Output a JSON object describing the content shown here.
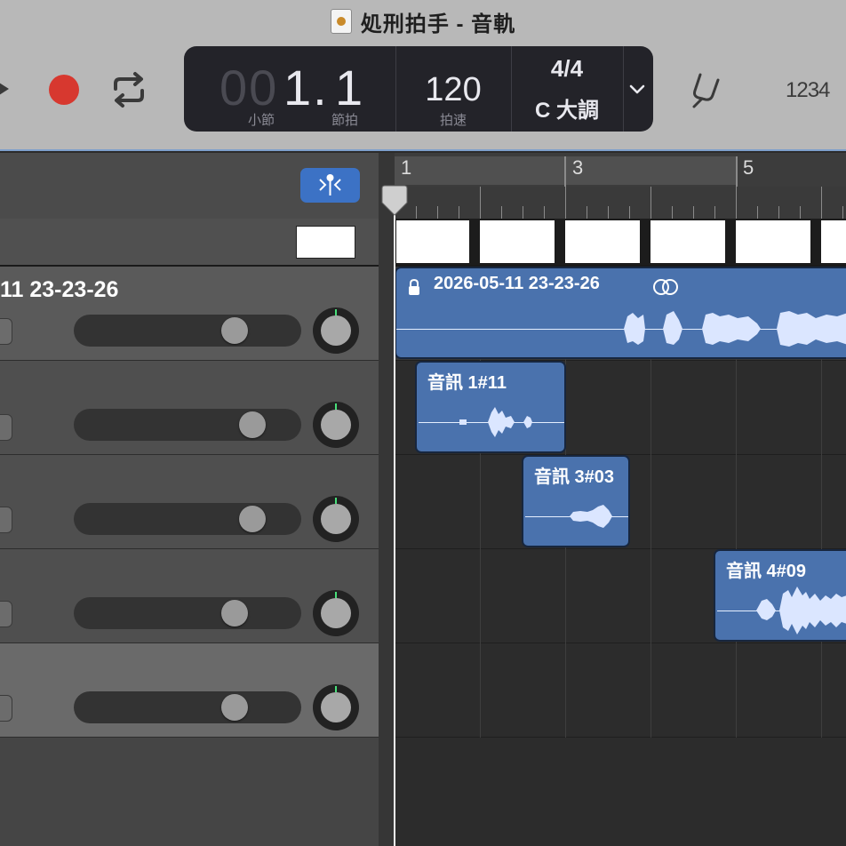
{
  "window": {
    "title": "処刑拍手 - 音軌"
  },
  "transport": {
    "play_icon": "play-icon",
    "record_icon": "record-icon",
    "cycle_icon": "cycle-icon"
  },
  "lcd": {
    "bar_dim": "00",
    "bar": "1.",
    "beat": "1",
    "bar_label": "小節",
    "beat_label": "節拍",
    "tempo": "120",
    "tempo_label": "拍速",
    "time_signature": "4/4",
    "key": "C 大調"
  },
  "toolbar": {
    "count_in": "1234",
    "tuner_icon": "tuning-fork-icon"
  },
  "ruler": {
    "markers": [
      "1",
      "3",
      "5"
    ]
  },
  "tracks": [
    {
      "name": "11 23-23-26",
      "volume": 0.66,
      "selected": true
    },
    {
      "name": "",
      "volume": 0.79,
      "selected": false
    },
    {
      "name": "",
      "volume": 0.79,
      "selected": false
    },
    {
      "name": "",
      "volume": 0.71,
      "selected": false
    },
    {
      "name": "",
      "volume": 0.71,
      "selected": false
    }
  ],
  "regions": [
    {
      "label": "2026-05-11 23-23-26",
      "locked": true,
      "linked": true
    },
    {
      "label": "音訊 1#11"
    },
    {
      "label": "音訊 3#03"
    },
    {
      "label": "音訊 4#09"
    }
  ],
  "colors": {
    "region": "#4a72ad",
    "record": "#d7382f",
    "smart_controls": "#3c72c5",
    "pan_indicator": "#48e07a"
  }
}
